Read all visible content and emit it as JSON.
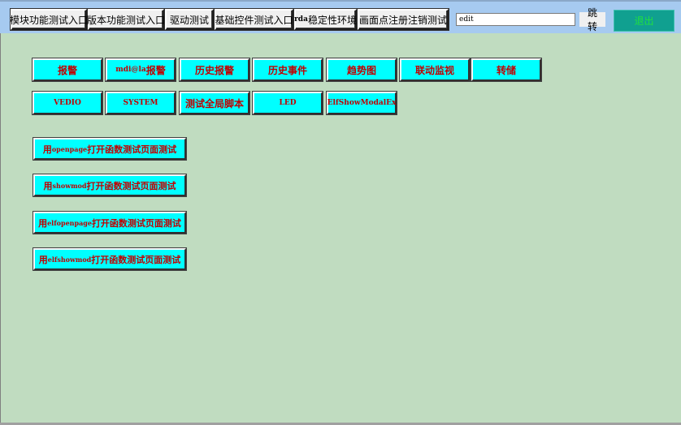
{
  "toolbar": {
    "nav_buttons": [
      {
        "label": "模块功能测试入口"
      },
      {
        "label": "版本功能测试入口"
      },
      {
        "label": "驱动测试"
      },
      {
        "label": "基础控件测试入口"
      },
      {
        "prefix": "rda",
        "label": "稳定性环境"
      },
      {
        "label": "画面点注册注销测试"
      }
    ],
    "edit_value": "edit",
    "jump_label": "跳转",
    "exit_label": "退出"
  },
  "row1": [
    {
      "label": "报警"
    },
    {
      "prefix": "mdi@la",
      "label": "报警"
    },
    {
      "label": "历史报警"
    },
    {
      "label": "历史事件"
    },
    {
      "label": "趋势图"
    },
    {
      "label": "联动监视"
    },
    {
      "label": "转储"
    }
  ],
  "row2": [
    {
      "label": "VEDIO"
    },
    {
      "label": "SYSTEM"
    },
    {
      "label": "测试全局脚本"
    },
    {
      "label": "LED"
    },
    {
      "label": "ElfShowModalEx"
    }
  ],
  "wide_buttons": [
    {
      "pre": "用",
      "mid": "openpage",
      "post": "打开函数测试页面测试"
    },
    {
      "pre": "用",
      "mid": "showmod",
      "post": "打开函数测试页面测试"
    },
    {
      "pre": "用",
      "mid": "elfopenpage",
      "post": "打开函数测试页面测试"
    },
    {
      "pre": "用",
      "mid": "elfshowmod",
      "post": "打开函数测试页面测试"
    }
  ]
}
